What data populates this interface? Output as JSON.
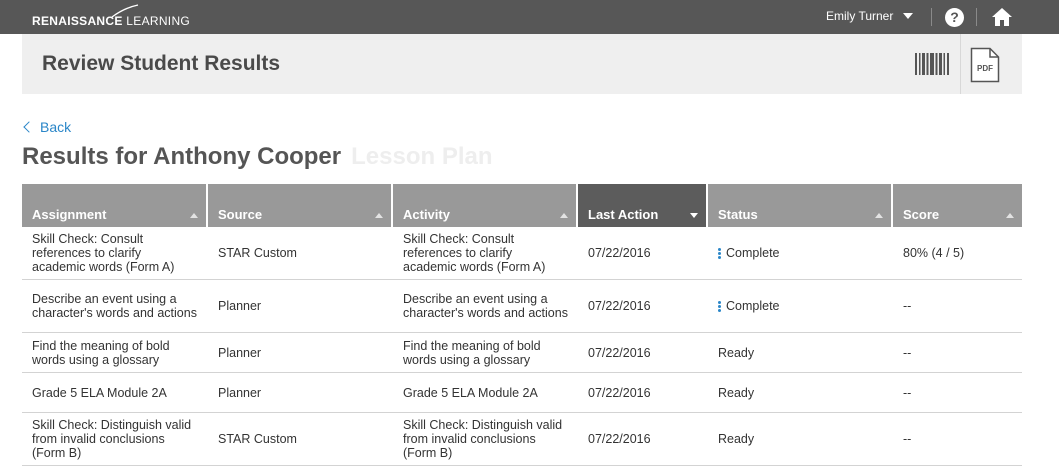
{
  "topbar": {
    "logo_bold": "RENAISSANCE",
    "logo_light": " LEARNING",
    "user_name": "Emily Turner"
  },
  "header": {
    "title": "Review Student Results",
    "pdf_label": "PDF"
  },
  "back_label": "Back",
  "results": {
    "title": "Results for Anthony Cooper",
    "ghost_text": "Lesson Plan"
  },
  "table": {
    "columns": [
      "Assignment",
      "Source",
      "Activity",
      "Last Action",
      "Status",
      "Score"
    ],
    "rows": [
      {
        "assignment": "Skill Check: Consult references to clarify academic words (Form A)",
        "source": "STAR Custom",
        "activity": "Skill Check: Consult references to clarify academic words (Form A)",
        "last_action": "07/22/2016",
        "status": "Complete",
        "score": "80% (4 / 5)"
      },
      {
        "assignment": "Describe an event using a character's words and actions",
        "source": "Planner",
        "activity": "Describe an event using a character's words and actions",
        "last_action": "07/22/2016",
        "status": "Complete",
        "score": "--"
      },
      {
        "assignment": "Find the meaning of bold words using a glossary",
        "source": "Planner",
        "activity": "Find the meaning of bold words using a glossary",
        "last_action": "07/22/2016",
        "status": "Ready",
        "score": "--"
      },
      {
        "assignment": "Grade 5 ELA Module 2A",
        "source": "Planner",
        "activity": "Grade 5 ELA Module 2A",
        "last_action": "07/22/2016",
        "status": "Ready",
        "score": "--"
      },
      {
        "assignment": "Skill Check: Distinguish valid from invalid conclusions (Form B)",
        "source": "STAR Custom",
        "activity": "Skill Check: Distinguish valid from invalid conclusions (Form B)",
        "last_action": "07/22/2016",
        "status": "Ready",
        "score": "--"
      }
    ]
  },
  "colors": {
    "topbar": "#575757",
    "header_bg": "#efefef",
    "column_header": "#999999",
    "column_header_active": "#5c5c5c",
    "link": "#2a86c8"
  }
}
